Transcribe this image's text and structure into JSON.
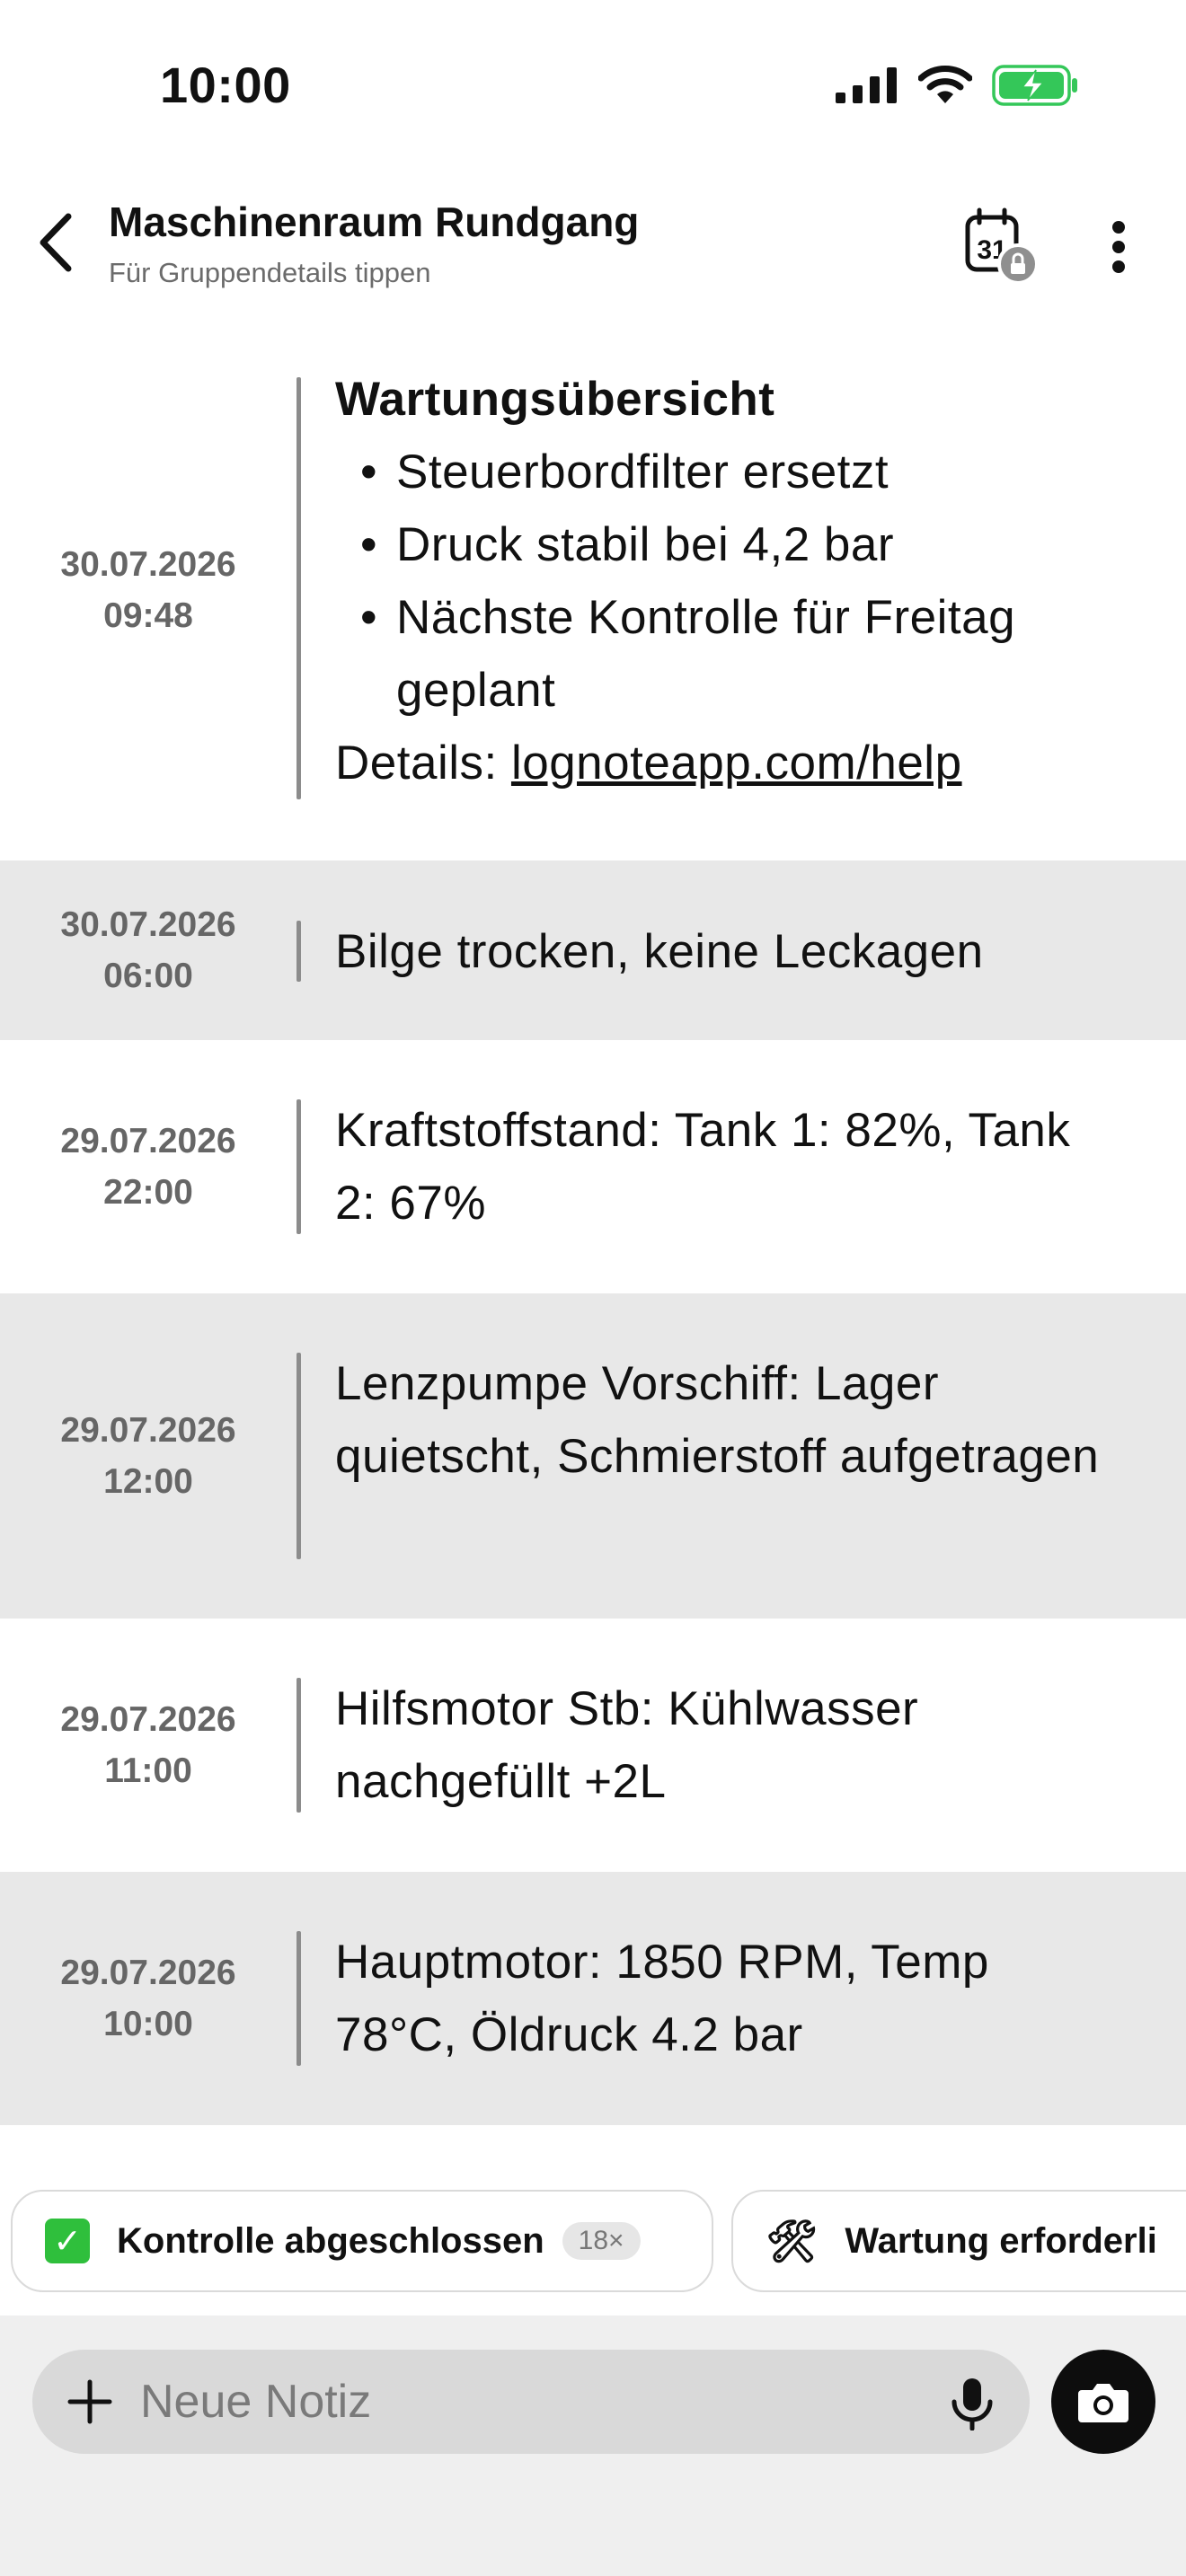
{
  "status_bar": {
    "time": "10:00",
    "icons": [
      "cellular-signal-icon",
      "wifi-icon",
      "battery-charging-icon"
    ],
    "battery_color": "#34c759"
  },
  "header": {
    "title": "Maschinenraum Rundgang",
    "subtitle": "Für Gruppendetails tippen",
    "calendar_day": "31",
    "icons": [
      "back-chevron-icon",
      "calendar-lock-icon",
      "more-vertical-icon"
    ]
  },
  "entries": [
    {
      "date": "30.07.2026",
      "time": "09:48",
      "summary": {
        "title": "Wartungsübersicht",
        "items": [
          "Steuerbordfilter ersetzt",
          "Druck stabil bei 4,2 bar",
          "Nächste Kontrolle für Freitag geplant"
        ],
        "details_label": "Details: ",
        "details_link": "lognoteapp.com/help"
      }
    },
    {
      "date": "30.07.2026",
      "time": "06:00",
      "text": "Bilge trocken, keine Leckagen"
    },
    {
      "date": "29.07.2026",
      "time": "22:00",
      "text": "Kraftstoffstand: Tank 1: 82%, Tank 2: 67%"
    },
    {
      "date": "29.07.2026",
      "time": "12:00",
      "text": "Lenzpumpe Vorschiff: Lager quietscht, Schmierstoff aufgetragen"
    },
    {
      "date": "29.07.2026",
      "time": "11:00",
      "text": "Hilfsmotor Stb: Kühlwasser nachgefüllt +2L"
    },
    {
      "date": "29.07.2026",
      "time": "10:00",
      "text": "Hauptmotor: 1850 RPM, Temp 78°C, Öldruck 4.2 bar"
    }
  ],
  "quick_chips": [
    {
      "icon": "checkmark-box-icon",
      "glyph": "✓",
      "label": "Kontrolle abgeschlossen",
      "count": "18×"
    },
    {
      "icon": "tools-icon",
      "glyph": "🛠",
      "label": "Wartung erforderli"
    }
  ],
  "compose": {
    "placeholder": "Neue Notiz",
    "icons": [
      "plus-icon",
      "microphone-icon",
      "camera-icon"
    ]
  },
  "colors": {
    "shaded_row": "#e8e8e8",
    "timestamp": "#666666",
    "divider": "#8c8c8c",
    "compose_bg": "#efefef",
    "input_bg": "#d9d9d9",
    "check_green": "#2fbf3c"
  }
}
